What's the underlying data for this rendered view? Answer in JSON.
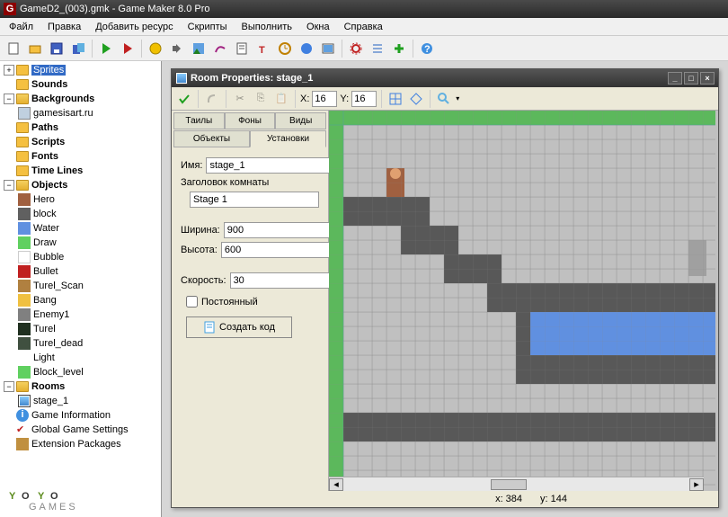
{
  "title": "GameD2_(003).gmk - Game Maker 8.0 Pro",
  "menus": [
    "Файл",
    "Правка",
    "Добавить ресурс",
    "Скрипты",
    "Выполнить",
    "Окна",
    "Справка"
  ],
  "tree": {
    "sprites": "Sprites",
    "sounds": "Sounds",
    "backgrounds": "Backgrounds",
    "bg_item": "gamesisart.ru",
    "paths": "Paths",
    "scripts": "Scripts",
    "fonts": "Fonts",
    "timelines": "Time Lines",
    "objects": "Objects",
    "obj": [
      "Hero",
      "block",
      "Water",
      "Draw",
      "Bubble",
      "Bullet",
      "Turel_Scan",
      "Bang",
      "Enemy1",
      "Turel",
      "Turel_dead",
      "Light",
      "Block_level"
    ],
    "rooms": "Rooms",
    "room_item": "stage_1",
    "game_info": "Game Information",
    "global_settings": "Global Game Settings",
    "extensions": "Extension Packages"
  },
  "subwin": {
    "title": "Room Properties: stage_1",
    "x_label": "X:",
    "x_val": "16",
    "y_label": "Y:",
    "y_val": "16",
    "tabs1": [
      "Таилы",
      "Фоны",
      "Виды"
    ],
    "tabs2": [
      "Объекты",
      "Установки"
    ],
    "name_label": "Имя:",
    "name_val": "stage_1",
    "caption_label": "Заголовок комнаты",
    "caption_val": "Stage 1",
    "width_label": "Ширина:",
    "width_val": "900",
    "height_label": "Высота:",
    "height_val": "600",
    "speed_label": "Скорость:",
    "speed_val": "30",
    "persistent": "Постоянный",
    "create_code": "Создать код",
    "status_x": "x: 384",
    "status_y": "y: 144"
  },
  "logo": "YoYo GAMES"
}
